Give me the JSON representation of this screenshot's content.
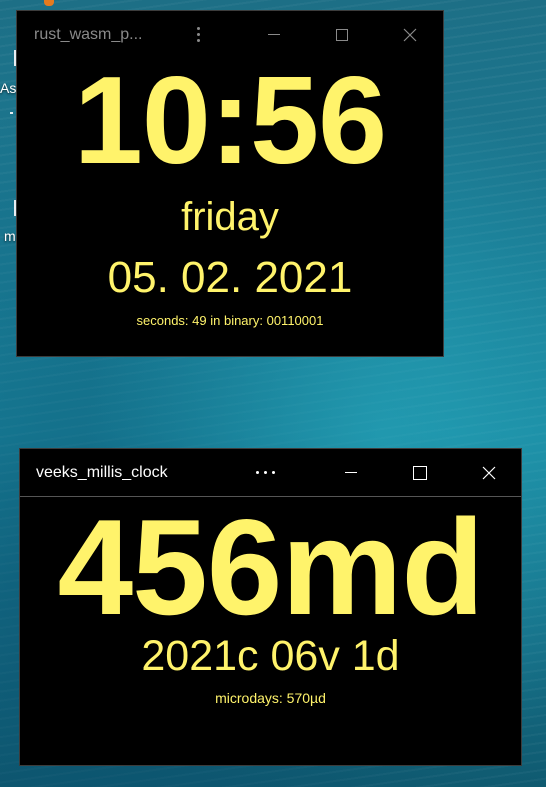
{
  "desktop": {
    "fragment_top": "As",
    "fragment_bottom": "m"
  },
  "colors": {
    "clock_text": "#fff36b",
    "window_bg": "#000000",
    "desktop_accent": "#1b8aa2"
  },
  "window1": {
    "title": "rust_wasm_p...",
    "icons": [
      "more-vertical-icon",
      "minimize-icon",
      "maximize-icon",
      "close-icon"
    ],
    "time": "10:56",
    "weekday": "friday",
    "date": "05. 02. 2021",
    "seconds_line": "seconds: 49 in binary: 00110001"
  },
  "window2": {
    "title": "veeks_millis_clock",
    "icons": [
      "more-horizontal-icon",
      "minimize-icon",
      "maximize-icon",
      "close-icon"
    ],
    "microdays_big": "456md",
    "date_line": "2021c 06v 1d",
    "microdays_line": "microdays: 570µd"
  }
}
